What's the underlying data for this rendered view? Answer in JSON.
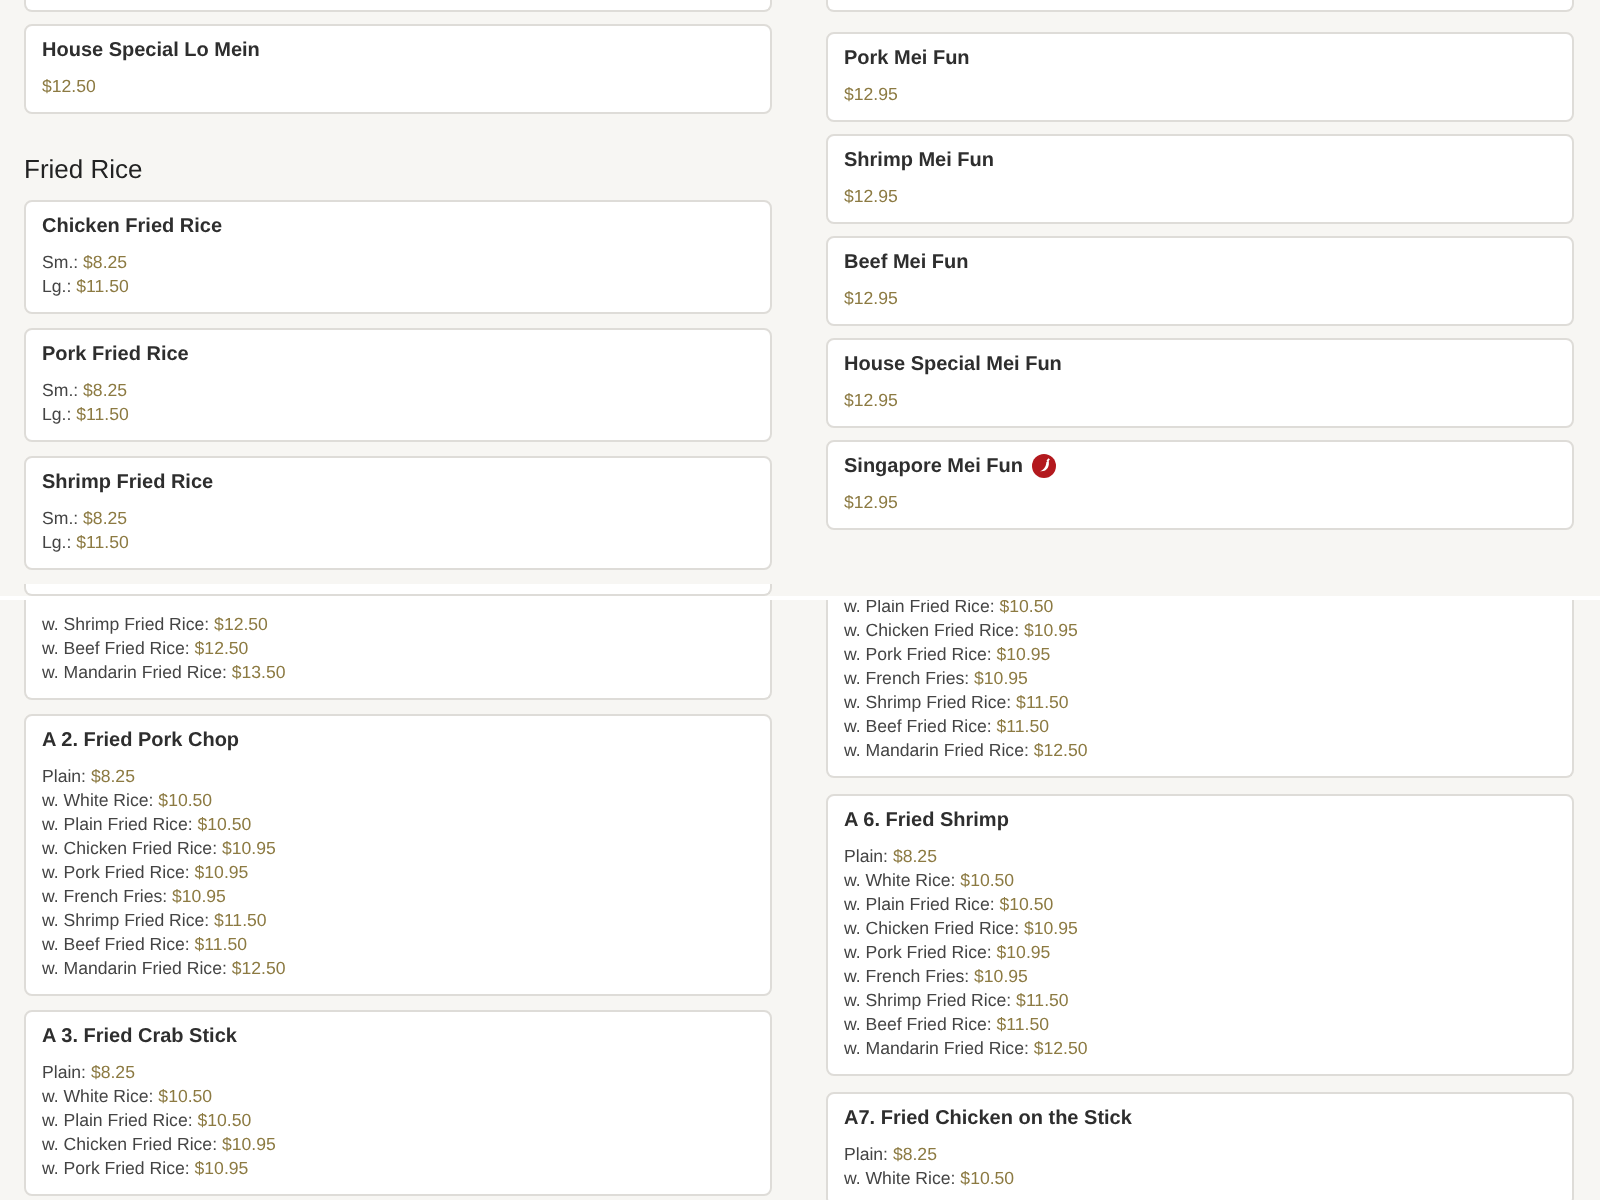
{
  "panels": [
    {
      "columns": [
        {
          "blocks": [
            {
              "kind": "stub"
            },
            {
              "kind": "card",
              "title": "House Special Lo Mein",
              "spicy": false,
              "prices": [
                {
                  "price": "$12.50"
                }
              ]
            },
            {
              "kind": "heading",
              "title": "Fried Rice"
            },
            {
              "kind": "card",
              "title": "Chicken Fried Rice",
              "spicy": false,
              "prices": [
                {
                  "label": "Sm.:",
                  "price": "$8.25"
                },
                {
                  "label": "Lg.:",
                  "price": "$11.50"
                }
              ]
            },
            {
              "kind": "card",
              "title": "Pork Fried Rice",
              "spicy": false,
              "prices": [
                {
                  "label": "Sm.:",
                  "price": "$8.25"
                },
                {
                  "label": "Lg.:",
                  "price": "$11.50"
                }
              ]
            },
            {
              "kind": "card",
              "title": "Shrimp Fried Rice",
              "spicy": false,
              "prices": [
                {
                  "label": "Sm.:",
                  "price": "$8.25"
                },
                {
                  "label": "Lg.:",
                  "price": "$11.50"
                }
              ]
            },
            {
              "kind": "stub"
            }
          ]
        },
        {
          "blocks": [
            {
              "kind": "stub"
            },
            {
              "kind": "card",
              "title": "Pork Mei Fun",
              "spicy": false,
              "prices": [
                {
                  "price": "$12.95"
                }
              ]
            },
            {
              "kind": "card",
              "title": "Shrimp Mei Fun",
              "spicy": false,
              "prices": [
                {
                  "price": "$12.95"
                }
              ]
            },
            {
              "kind": "card",
              "title": "Beef Mei Fun",
              "spicy": false,
              "prices": [
                {
                  "price": "$12.95"
                }
              ]
            },
            {
              "kind": "card",
              "title": "House Special Mei Fun",
              "spicy": false,
              "prices": [
                {
                  "price": "$12.95"
                }
              ]
            },
            {
              "kind": "card",
              "title": "Singapore Mei Fun",
              "spicy": true,
              "prices": [
                {
                  "price": "$12.95"
                }
              ]
            }
          ]
        }
      ]
    },
    {
      "columns": [
        {
          "blocks": [
            {
              "kind": "continued",
              "prices": [
                {
                  "label": "w. Shrimp Fried Rice:",
                  "price": "$12.50"
                },
                {
                  "label": "w. Beef Fried Rice:",
                  "price": "$12.50"
                },
                {
                  "label": "w. Mandarin Fried Rice:",
                  "price": "$13.50"
                }
              ]
            },
            {
              "kind": "card",
              "title": "A 2. Fried Pork Chop",
              "spicy": false,
              "prices": [
                {
                  "label": "Plain:",
                  "price": "$8.25"
                },
                {
                  "label": "w. White Rice:",
                  "price": "$10.50"
                },
                {
                  "label": "w. Plain Fried Rice:",
                  "price": "$10.50"
                },
                {
                  "label": "w. Chicken Fried Rice:",
                  "price": "$10.95"
                },
                {
                  "label": "w. Pork Fried Rice:",
                  "price": "$10.95"
                },
                {
                  "label": "w. French Fries:",
                  "price": "$10.95"
                },
                {
                  "label": "w. Shrimp Fried Rice:",
                  "price": "$11.50"
                },
                {
                  "label": "w. Beef Fried Rice:",
                  "price": "$11.50"
                },
                {
                  "label": "w. Mandarin Fried Rice:",
                  "price": "$12.50"
                }
              ]
            },
            {
              "kind": "card",
              "title": "A 3. Fried Crab Stick",
              "spicy": false,
              "prices": [
                {
                  "label": "Plain:",
                  "price": "$8.25"
                },
                {
                  "label": "w. White Rice:",
                  "price": "$10.50"
                },
                {
                  "label": "w. Plain Fried Rice:",
                  "price": "$10.50"
                },
                {
                  "label": "w. Chicken Fried Rice:",
                  "price": "$10.95"
                },
                {
                  "label": "w. Pork Fried Rice:",
                  "price": "$10.95"
                }
              ]
            }
          ]
        },
        {
          "blocks": [
            {
              "kind": "continued",
              "prices": [
                {
                  "label": "w. Plain Fried Rice:",
                  "price": "$10.50"
                },
                {
                  "label": "w. Chicken Fried Rice:",
                  "price": "$10.95"
                },
                {
                  "label": "w. Pork Fried Rice:",
                  "price": "$10.95"
                },
                {
                  "label": "w. French Fries:",
                  "price": "$10.95"
                },
                {
                  "label": "w. Shrimp Fried Rice:",
                  "price": "$11.50"
                },
                {
                  "label": "w. Beef Fried Rice:",
                  "price": "$11.50"
                },
                {
                  "label": "w. Mandarin Fried Rice:",
                  "price": "$12.50"
                }
              ]
            },
            {
              "kind": "card",
              "title": "A 6. Fried Shrimp",
              "spicy": false,
              "prices": [
                {
                  "label": "Plain:",
                  "price": "$8.25"
                },
                {
                  "label": "w. White Rice:",
                  "price": "$10.50"
                },
                {
                  "label": "w. Plain Fried Rice:",
                  "price": "$10.50"
                },
                {
                  "label": "w. Chicken Fried Rice:",
                  "price": "$10.95"
                },
                {
                  "label": "w. Pork Fried Rice:",
                  "price": "$10.95"
                },
                {
                  "label": "w. French Fries:",
                  "price": "$10.95"
                },
                {
                  "label": "w. Shrimp Fried Rice:",
                  "price": "$11.50"
                },
                {
                  "label": "w. Beef Fried Rice:",
                  "price": "$11.50"
                },
                {
                  "label": "w. Mandarin Fried Rice:",
                  "price": "$12.50"
                }
              ]
            },
            {
              "kind": "card",
              "title": "A7. Fried Chicken on the Stick",
              "spicy": false,
              "prices": [
                {
                  "label": "Plain:",
                  "price": "$8.25"
                },
                {
                  "label": "w. White Rice:",
                  "price": "$10.50"
                }
              ]
            }
          ]
        }
      ]
    }
  ]
}
